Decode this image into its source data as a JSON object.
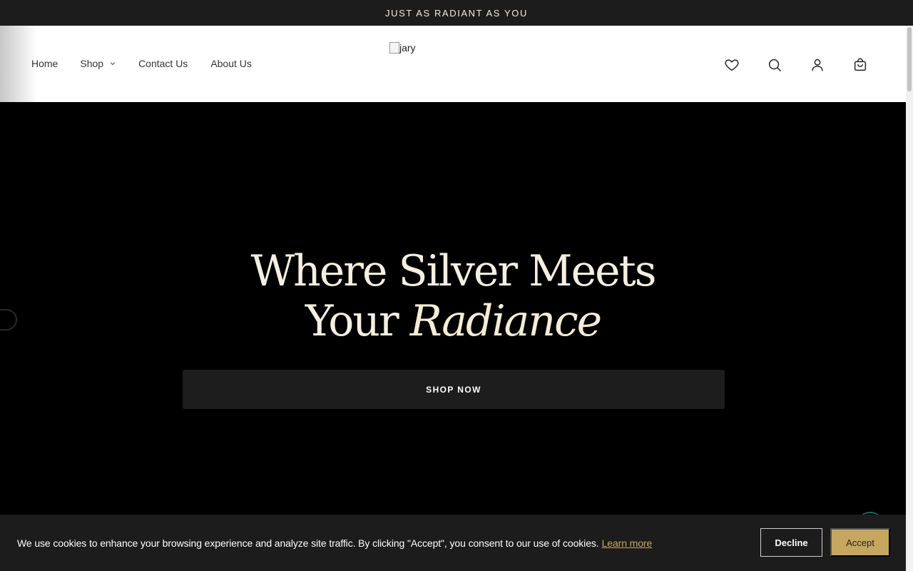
{
  "announcement": {
    "text": "JUST AS RADIANT AS YOU"
  },
  "nav": {
    "items": [
      {
        "label": "Home"
      },
      {
        "label": "Shop"
      },
      {
        "label": "Contact Us"
      },
      {
        "label": "About Us"
      }
    ]
  },
  "logo": {
    "alt": "jary"
  },
  "header_icons": [
    "heart-icon",
    "search-icon",
    "account-icon",
    "cart-icon"
  ],
  "hero": {
    "line1": "Where Silver Meets",
    "line2_plain": "Your",
    "line2_accent": "Radiance",
    "cta_label": "SHOP NOW"
  },
  "cookie": {
    "message": "We use cookies to enhance your browsing experience and analyze site traffic. By clicking \"Accept\", you consent to our use of cookies.",
    "learn_more": "Learn more",
    "decline_label": "Decline",
    "accept_label": "Accept"
  },
  "colors": {
    "announcement_bg": "#1c1c1c",
    "hero_bg": "#000000",
    "accent_gold": "#c7a65f",
    "cta_bg": "#1d1d1d"
  }
}
